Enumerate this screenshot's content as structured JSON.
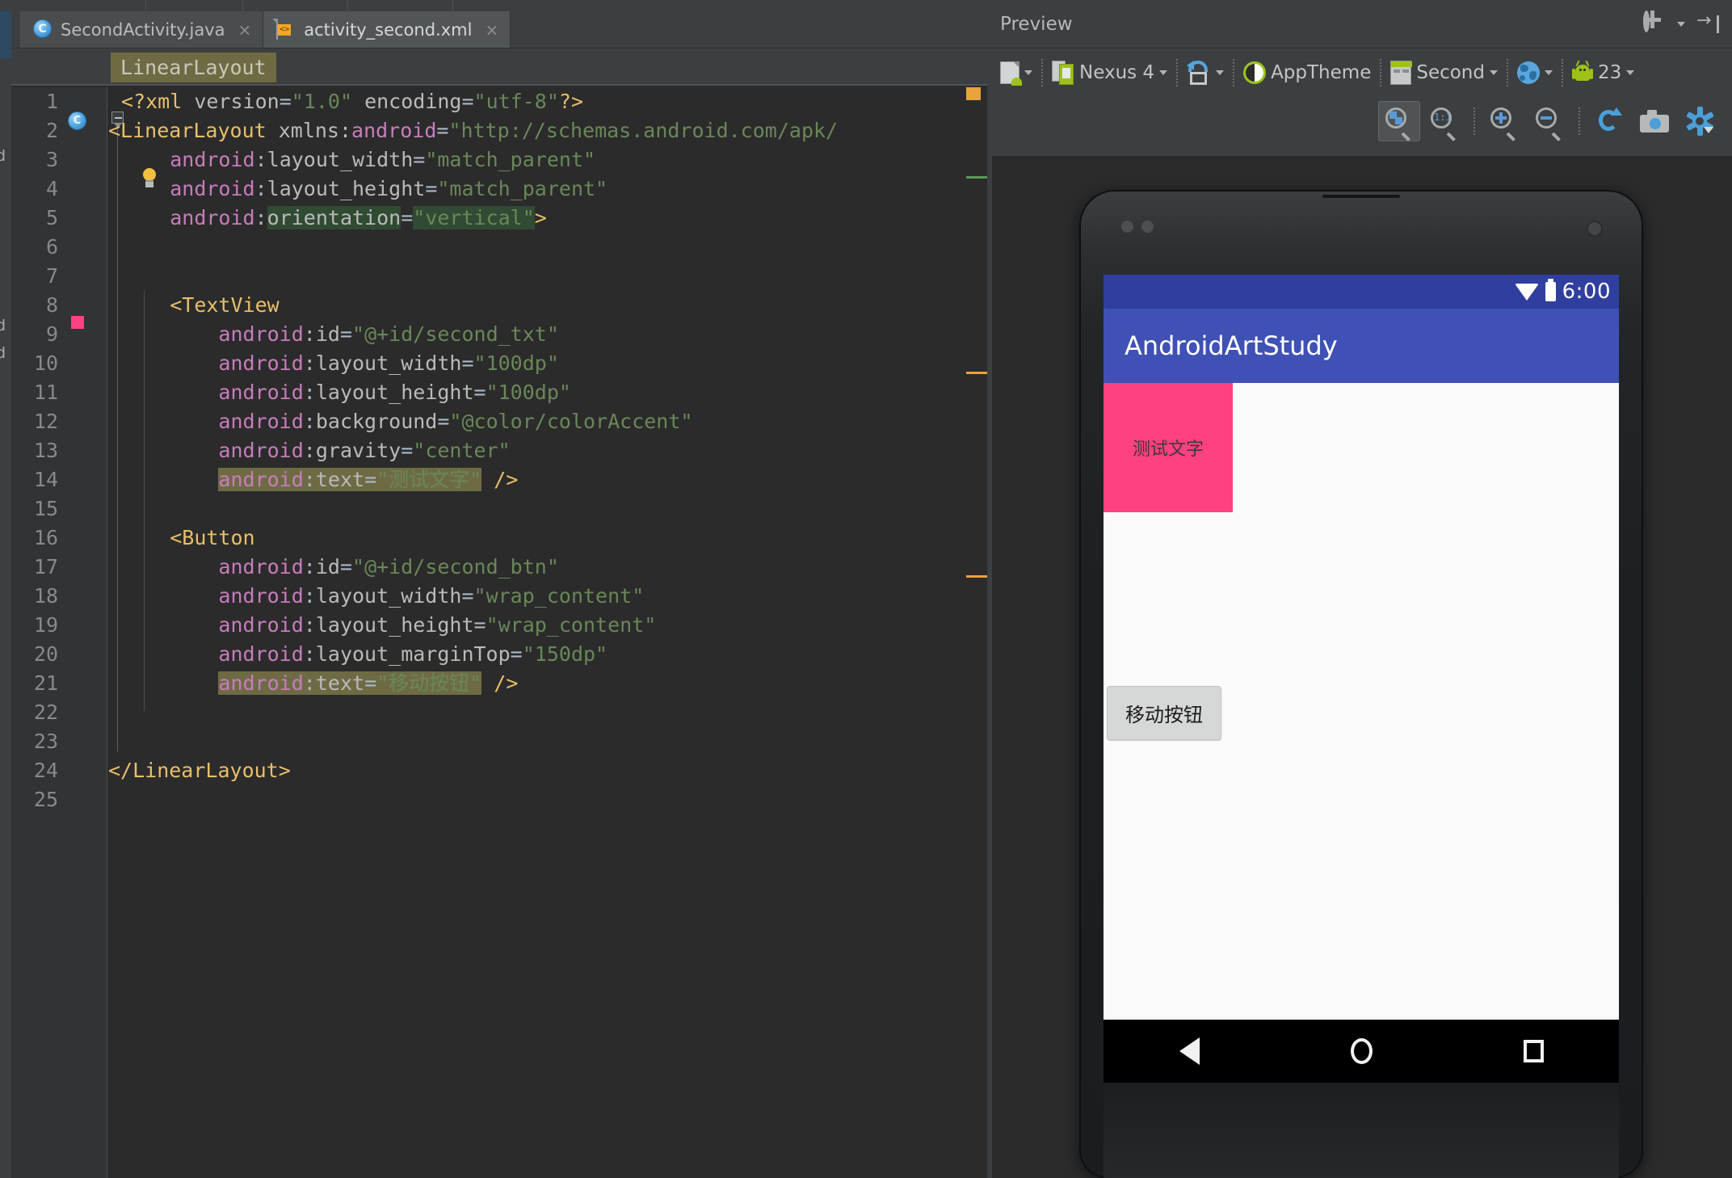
{
  "editor": {
    "tabs": [
      {
        "label": "SecondActivity.java",
        "icon": "java-class-icon",
        "close": "×",
        "active": false
      },
      {
        "label": "activity_second.xml",
        "icon": "xml-file-icon",
        "close": "×",
        "active": true
      }
    ],
    "breadcrumb": "LinearLayout",
    "line_numbers": [
      "1",
      "2",
      "3",
      "4",
      "5",
      "6",
      "7",
      "8",
      "9",
      "10",
      "11",
      "12",
      "13",
      "14",
      "15",
      "16",
      "17",
      "18",
      "19",
      "20",
      "21",
      "22",
      "23",
      "24",
      "25"
    ],
    "gutter_color_swatch": "#ff4081",
    "code_lines": [
      {
        "n": "1",
        "text": "<?xml version=\"1.0\" encoding=\"utf-8\"?>"
      },
      {
        "n": "2",
        "text": "<LinearLayout xmlns:android=\"http://schemas.android.com/apk/"
      },
      {
        "n": "3",
        "text": "    android:layout_width=\"match_parent\""
      },
      {
        "n": "4",
        "text": "    android:layout_height=\"match_parent\""
      },
      {
        "n": "5",
        "text": "    android:orientation=\"vertical\">"
      },
      {
        "n": "6",
        "text": ""
      },
      {
        "n": "7",
        "text": ""
      },
      {
        "n": "8",
        "text": "    <TextView"
      },
      {
        "n": "9",
        "text": "        android:id=\"@+id/second_txt\""
      },
      {
        "n": "10",
        "text": "        android:layout_width=\"100dp\""
      },
      {
        "n": "11",
        "text": "        android:layout_height=\"100dp\""
      },
      {
        "n": "12",
        "text": "        android:background=\"@color/colorAccent\""
      },
      {
        "n": "13",
        "text": "        android:gravity=\"center\""
      },
      {
        "n": "14",
        "text": "        android:text=\"测试文字\" />"
      },
      {
        "n": "15",
        "text": ""
      },
      {
        "n": "16",
        "text": "    <Button"
      },
      {
        "n": "17",
        "text": "        android:id=\"@+id/second_btn\""
      },
      {
        "n": "18",
        "text": "        android:layout_width=\"wrap_content\""
      },
      {
        "n": "19",
        "text": "        android:layout_height=\"wrap_content\""
      },
      {
        "n": "20",
        "text": "        android:layout_marginTop=\"150dp\""
      },
      {
        "n": "21",
        "text": "        android:text=\"移动按钮\" />"
      },
      {
        "n": "22",
        "text": ""
      },
      {
        "n": "23",
        "text": ""
      },
      {
        "n": "24",
        "text": "</LinearLayout>"
      },
      {
        "n": "25",
        "text": ""
      }
    ],
    "tokens": {
      "prolog_open": "<?xml",
      "prolog_attr_version": " version=",
      "prolog_val_version": "\"1.0\"",
      "prolog_attr_encoding": " encoding=",
      "prolog_val_encoding": "\"utf-8\"",
      "prolog_close": "?>",
      "tag_linearlayout_open": "<LinearLayout",
      "attr_xmlns": " xmlns:android",
      "eq": "=",
      "val_xmlns": "\"http://schemas.android.com/apk/",
      "ns_android": "android",
      "colon": ":",
      "attr_layout_width": "layout_width",
      "val_match_parent": "\"match_parent\"",
      "attr_layout_height": "layout_height",
      "attr_orientation": "orientation",
      "val_vertical": "\"vertical\"",
      "gt": ">",
      "tag_textview": "<TextView",
      "attr_id": "id",
      "val_id_txt": "\"@+id/second_txt\"",
      "val_100dp": "\"100dp\"",
      "attr_background": "background",
      "val_color_accent": "\"@color/colorAccent\"",
      "attr_gravity": "gravity",
      "val_center": "\"center\"",
      "attr_text": "text",
      "val_text_cn_txt": "\"测试文字\"",
      "selfclose": "/>",
      "tag_button": "<Button",
      "val_id_btn": "\"@+id/second_btn\"",
      "val_wrap_content": "\"wrap_content\"",
      "attr_margin_top": "layout_marginTop",
      "val_150dp": "\"150dp\"",
      "val_text_cn_btn": "\"移动按钮\"",
      "tag_linearlayout_close": "</LinearLayout>"
    },
    "rail_letters": [
      "d",
      "d",
      "d"
    ]
  },
  "preview": {
    "title": "Preview",
    "header_icons": [
      "gear-icon",
      "collapse-panel-icon"
    ],
    "toolbar": [
      {
        "name": "file-variant",
        "label": "",
        "icon": "document-android-icon",
        "caret": "▾"
      },
      {
        "name": "device",
        "label": "Nexus 4",
        "icon": "device-icon",
        "caret": "▾"
      },
      {
        "name": "orientation",
        "label": "",
        "icon": "rotate-icon",
        "caret": "▾"
      },
      {
        "name": "theme",
        "label": "AppTheme",
        "icon": "theme-contrast-icon",
        "caret": ""
      },
      {
        "name": "activity",
        "label": "Second",
        "icon": "activity-icon",
        "caret": "▾"
      },
      {
        "name": "locale",
        "label": "",
        "icon": "globe-icon",
        "caret": "▾"
      },
      {
        "name": "api-level",
        "label": "23",
        "icon": "android-icon",
        "caret": "▾"
      }
    ],
    "toolbar2": [
      {
        "name": "zoom-to-fit-button",
        "icon": "zoom-fit-icon",
        "active": true
      },
      {
        "name": "zoom-actual-size-button",
        "icon": "zoom-1-1-icon",
        "label": "1:1",
        "active": false
      },
      {
        "name": "zoom-in-button",
        "icon": "zoom-in-icon",
        "active": false
      },
      {
        "name": "zoom-out-button",
        "icon": "zoom-out-icon",
        "active": false
      },
      {
        "name": "refresh-button",
        "icon": "refresh-icon",
        "active": false
      },
      {
        "name": "screenshot-button",
        "icon": "camera-icon",
        "active": false
      },
      {
        "name": "settings-button",
        "icon": "gear-icon",
        "active": false
      }
    ]
  },
  "device_preview": {
    "status_bar": {
      "time": "6:00",
      "icons": [
        "wifi-icon",
        "battery-icon"
      ]
    },
    "app_bar": {
      "title": "AndroidArtStudy",
      "color": "#3f51b5"
    },
    "status_bar_color": "#303f9f",
    "textview": {
      "text": "测试文字",
      "background": "#ff4081",
      "width": "100dp",
      "height": "100dp"
    },
    "button": {
      "text": "移动按钮"
    },
    "nav_bar": {
      "buttons": [
        "back-icon",
        "home-icon",
        "recents-icon"
      ]
    }
  }
}
